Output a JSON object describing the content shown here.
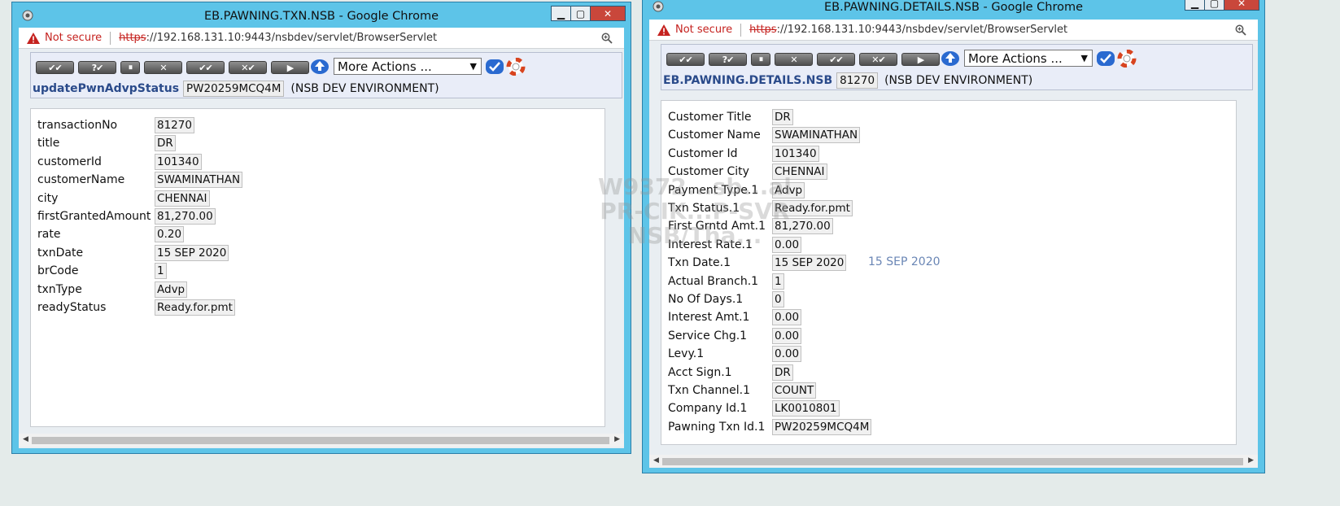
{
  "left_window": {
    "title": "EB.PAWNING.TXN.NSB - Google Chrome",
    "not_secure": "Not secure",
    "url_scheme": "https",
    "url_rest": "://192.168.131.10:9443/nsbdev/servlet/BrowserServlet",
    "more_actions": "More Actions ...",
    "app_name": "updatePwnAdvpStatus",
    "record_id": "PW20259MCQ4M",
    "environment": "(NSB DEV ENVIRONMENT)",
    "fields": [
      {
        "label": "transactionNo",
        "value": "81270"
      },
      {
        "label": "title",
        "value": "DR"
      },
      {
        "label": "customerId",
        "value": "101340"
      },
      {
        "label": "customerName",
        "value": "SWAMINATHAN"
      },
      {
        "label": "city",
        "value": "CHENNAI"
      },
      {
        "label": "firstGrantedAmount",
        "value": "81,270.00"
      },
      {
        "label": "rate",
        "value": "0.20"
      },
      {
        "label": "txnDate",
        "value": "15 SEP 2020"
      },
      {
        "label": "brCode",
        "value": "1"
      },
      {
        "label": "txnType",
        "value": "Advp"
      },
      {
        "label": "readyStatus",
        "value": "Ready.for.pmt"
      }
    ]
  },
  "right_window": {
    "title": "EB.PAWNING.DETAILS.NSB - Google Chrome",
    "not_secure": "Not secure",
    "url_scheme": "https",
    "url_rest": "://192.168.131.10:9443/nsbdev/servlet/BrowserServlet",
    "more_actions": "More Actions ...",
    "app_name": "EB.PAWNING.DETAILS.NSB",
    "record_id": "81270",
    "environment": "(NSB DEV ENVIRONMENT)",
    "txn_date_enrichment": "15 SEP 2020",
    "fields": [
      {
        "label": "Customer Title",
        "value": "DR"
      },
      {
        "label": "Customer Name",
        "value": "SWAMINATHAN"
      },
      {
        "label": "Customer Id",
        "value": "101340"
      },
      {
        "label": "Customer City",
        "value": "CHENNAI"
      },
      {
        "label": "Payment Type.1",
        "value": "Advp"
      },
      {
        "label": "Txn Status.1",
        "value": "Ready.for.pmt"
      },
      {
        "label": "First Grntd Amt.1",
        "value": "81,270.00"
      },
      {
        "label": "Interest Rate.1",
        "value": "0.00"
      },
      {
        "label": "Txn Date.1",
        "value": "15 SEP 2020"
      },
      {
        "label": "Actual Branch.1",
        "value": "1"
      },
      {
        "label": "No Of Days.1",
        "value": "0"
      },
      {
        "label": "Interest Amt.1",
        "value": "0.00"
      },
      {
        "label": "Service Chg.1",
        "value": "0.00"
      },
      {
        "label": "Levy.1",
        "value": "0.00"
      },
      {
        "label": "Acct Sign.1",
        "value": "DR"
      },
      {
        "label": "Txn Channel.1",
        "value": "COUNT"
      },
      {
        "label": "Company Id.1",
        "value": "LK0010801"
      },
      {
        "label": "Pawning Txn Id.1",
        "value": "PW20259MCQ4M"
      }
    ]
  },
  "toolbar_buttons": [
    "✔✔",
    "?✔",
    "⏸",
    "✕",
    "✔✔",
    "✕✔",
    "▶"
  ],
  "colors": {
    "window_frame": "#5dc4e8",
    "close_button": "#c9473b",
    "app_name": "#2a4a8a",
    "not_secure": "#c5221f"
  },
  "watermark": [
    "W9372...sb...al",
    "PR-CIK...P-SVR",
    "NSB/Tha..."
  ]
}
